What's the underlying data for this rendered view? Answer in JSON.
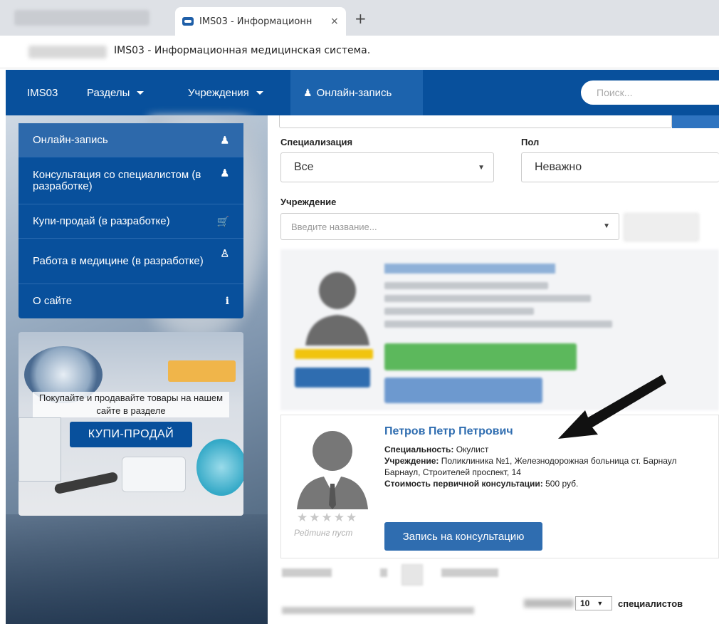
{
  "browser": {
    "tab_title": "IMS03 - Информационн",
    "tab_close": "×",
    "new_tab": "+",
    "address_title": "IMS03 - Информационная медицинская система."
  },
  "navbar": {
    "brand": "IMS03",
    "sections": "Разделы",
    "institutions": "Учреждения",
    "online": "Онлайн-запись",
    "search_placeholder": "Поиск..."
  },
  "sidebar": {
    "items": [
      {
        "label": "Онлайн-запись",
        "icon": "user-md-icon"
      },
      {
        "label": "Консультация со специалистом (в разработке)",
        "icon": "user-md-icon"
      },
      {
        "label": "Купи-продай (в разработке)",
        "icon": "cart-icon"
      },
      {
        "label": "Работа в медицине (в разработке)",
        "icon": "users-icon"
      },
      {
        "label": "О сайте",
        "icon": "info-icon"
      }
    ]
  },
  "ad": {
    "text": "Покупайте и продавайте товары на нашем сайте в разделе",
    "button": "КУПИ-ПРОДАЙ"
  },
  "filters": {
    "spec_label": "Специализация",
    "spec_value": "Все",
    "gender_label": "Пол",
    "gender_value": "Неважно",
    "inst_label": "Учреждение",
    "inst_placeholder": "Введите название..."
  },
  "doctor": {
    "name": "Петров Петр Петрович",
    "spec_label": "Специальность:",
    "spec_value": "Окулист",
    "inst_label": "Учреждение:",
    "inst_value": "Поликлиника №1, Железнодорожная больница ст. Барнаул",
    "address": "Барнаул, Строителей проспект, 14",
    "price_label": "Стоимость первичной консультации:",
    "price_value": "500 руб.",
    "stars": "★★★★★",
    "rating_text": "Рейтинг пуст",
    "book_button": "Запись на консультацию"
  },
  "footer": {
    "per_page": "10",
    "per_page_suffix": "специалистов"
  },
  "colors": {
    "navbar": "#08509c",
    "link": "#2f6db0"
  }
}
